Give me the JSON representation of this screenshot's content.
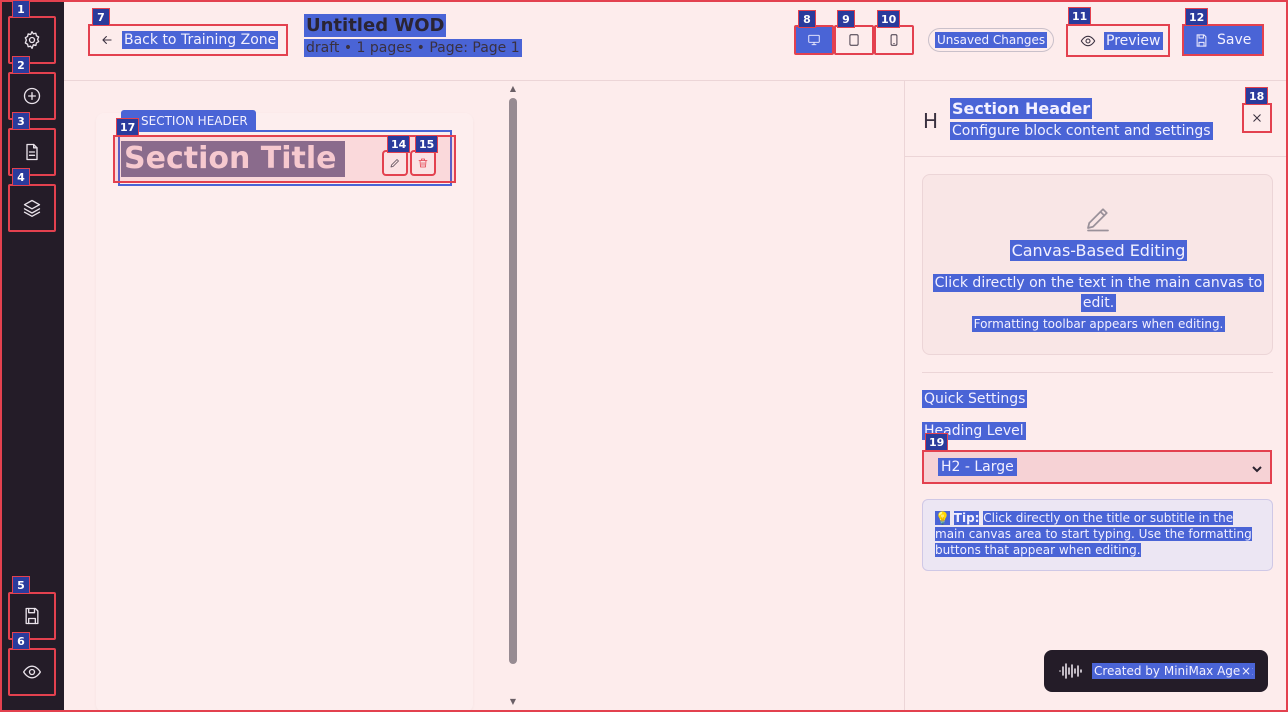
{
  "topbar": {
    "back_label": "Back to Training Zone",
    "doc_title": "Untitled WOD",
    "doc_meta": "draft • 1 pages • Page: Page 1",
    "unsaved_label": "Unsaved Changes",
    "preview_label": "Preview",
    "save_label": "Save",
    "view_modes": [
      "desktop",
      "tablet",
      "mobile"
    ],
    "active_view": "desktop"
  },
  "rail": {
    "items": [
      {
        "icon": "gear-icon"
      },
      {
        "icon": "plus-circle-icon"
      },
      {
        "icon": "document-icon"
      },
      {
        "icon": "layers-icon"
      },
      {
        "icon": "save-icon"
      },
      {
        "icon": "eye-icon"
      }
    ]
  },
  "canvas": {
    "block_tag": "SECTION HEADER",
    "section_title": "Section Title"
  },
  "panel": {
    "heading_glyph": "H",
    "title": "Section Header",
    "subtitle": "Configure block content and settings",
    "info_title": "Canvas-Based Editing",
    "info_text": "Click directly on the text in the main canvas to edit.",
    "info_small": "Formatting toolbar appears when editing.",
    "quick_settings": "Quick Settings",
    "heading_level_label": "Heading Level",
    "heading_level_value": "H2 - Large",
    "tip_icon": "💡",
    "tip_label": "Tip:",
    "tip_text": "Click directly on the title or subtitle in the main canvas area to start typing. Use the formatting buttons that appear when editing."
  },
  "badge": {
    "text": "Created by MiniMax Agent",
    "close": "×"
  },
  "markers": [
    "1",
    "2",
    "3",
    "4",
    "5",
    "6",
    "7",
    "8",
    "9",
    "10",
    "11",
    "12",
    "14",
    "15",
    "17",
    "18",
    "19"
  ],
  "colors": {
    "accent": "#4a64d6",
    "annotation": "#e3414f",
    "rail": "#241c28",
    "background": "#fdecec"
  }
}
